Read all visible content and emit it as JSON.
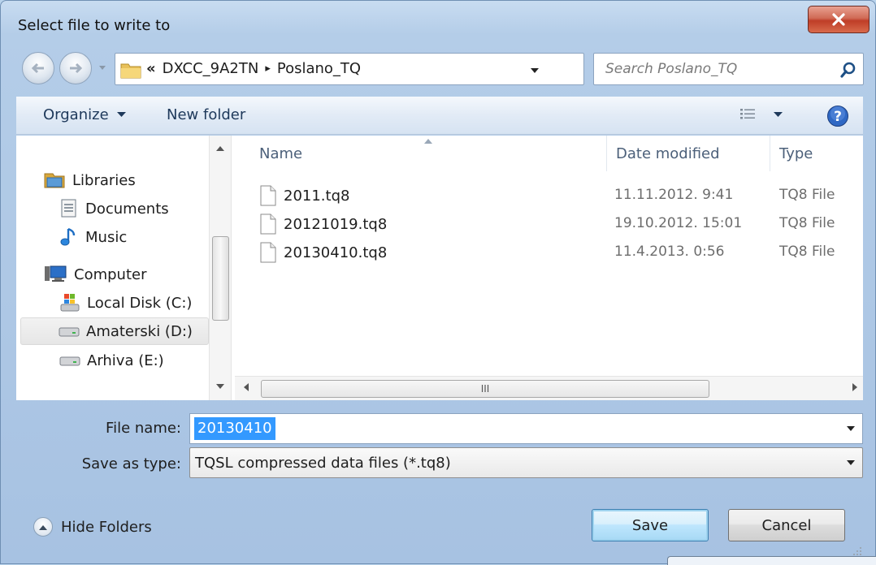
{
  "window": {
    "title": "Select file to write to"
  },
  "address_bar": {
    "overflow": "«",
    "crumbs": [
      "DXCC_9A2TN",
      "Poslano_TQ"
    ],
    "separator": "▸"
  },
  "search": {
    "placeholder": "Search Poslano_TQ"
  },
  "toolbar": {
    "organize_label": "Organize",
    "new_folder_label": "New folder"
  },
  "nav_pane": {
    "items": [
      {
        "label": "Libraries",
        "icon": "libraries-icon"
      },
      {
        "label": "Documents",
        "icon": "documents-icon"
      },
      {
        "label": "Music",
        "icon": "music-icon"
      },
      {
        "label": "Computer",
        "icon": "computer-icon"
      },
      {
        "label": "Local Disk (C:)",
        "icon": "system-drive-icon"
      },
      {
        "label": "Amaterski (D:)",
        "icon": "drive-icon",
        "selected": true
      },
      {
        "label": "Arhiva (E:)",
        "icon": "drive-icon"
      }
    ]
  },
  "file_list": {
    "columns": [
      "Name",
      "Date modified",
      "Type"
    ],
    "rows": [
      {
        "name": "2011.tq8",
        "date": "11.11.2012. 9:41",
        "type": "TQ8 File"
      },
      {
        "name": "20121019.tq8",
        "date": "19.10.2012. 15:01",
        "type": "TQ8 File"
      },
      {
        "name": "20130410.tq8",
        "date": "11.4.2013. 0:56",
        "type": "TQ8 File"
      }
    ],
    "hscroll_thumb": "III"
  },
  "form": {
    "file_name_label": "File name:",
    "file_name_value": "20130410",
    "save_as_type_label": "Save as type:",
    "save_as_type_value": "TQSL compressed data files (*.tq8)"
  },
  "footer": {
    "hide_folders_label": "Hide Folders",
    "save_label": "Save",
    "cancel_label": "Cancel"
  },
  "colors": {
    "selection": "#3399ff",
    "close_button": "#c8452f",
    "link_text": "#1e395b"
  }
}
